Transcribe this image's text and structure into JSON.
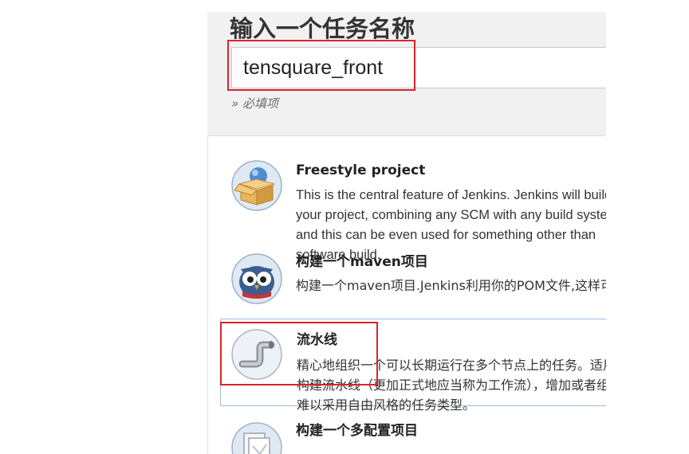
{
  "form": {
    "heading": "输入一个任务名称",
    "name_value": "tensquare_front",
    "required_note": "» 必填项"
  },
  "item_types": [
    {
      "title": "Freestyle project",
      "desc": "This is the central feature of Jenkins. Jenkins will build your project, combining any SCM with any build system, and this can be even used for something other than software build.",
      "icon": "freestyle-box-icon"
    },
    {
      "title": "构建一个maven项目",
      "desc": "构建一个maven项目.Jenkins利用你的POM文件,这样可以大大减轻构建配置.",
      "icon": "maven-owl-icon"
    },
    {
      "title": "流水线",
      "desc": "精心地组织一个可以长期运行在多个节点上的任务。适用于构建流水线（更加正式地应当称为工作流），增加或者组织难以采用自由风格的任务类型。",
      "icon": "pipeline-icon",
      "selected": true
    },
    {
      "title": "构建一个多配置项目",
      "icon": "multi-config-icon"
    }
  ],
  "colors": {
    "highlight": "#d9232f",
    "selected_border": "#9cb9df",
    "section_bg": "#f1f1f1"
  }
}
